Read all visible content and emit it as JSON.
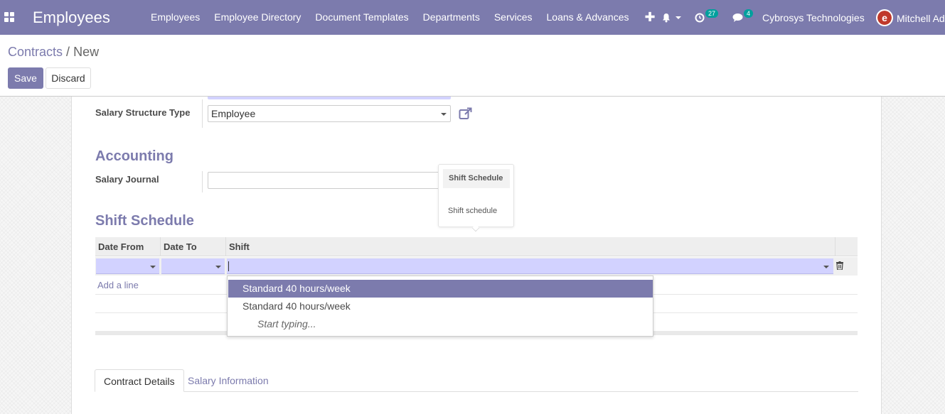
{
  "navbar": {
    "app_title": "Employees",
    "menu": [
      "Employees",
      "Employee Directory",
      "Document Templates",
      "Departments",
      "Services",
      "Loans & Advances"
    ],
    "plus": "✚",
    "activity_count": "27",
    "messages_count": "4",
    "company": "Cybrosys Technologies",
    "user": "Mitchell Admin",
    "accent_color": "#7c7bad"
  },
  "control_panel": {
    "breadcrumb_parent": "Contracts",
    "breadcrumb_separator": "/",
    "breadcrumb_current": "New",
    "save_label": "Save",
    "discard_label": "Discard"
  },
  "form": {
    "salary_structure_type_label": "Salary Structure Type",
    "salary_structure_type_value": "Employee",
    "accounting_title": "Accounting",
    "salary_journal_label": "Salary Journal",
    "salary_journal_value": "",
    "shift_schedule_title": "Shift Schedule"
  },
  "tooltip": {
    "title": "Shift Schedule",
    "body": "Shift schedule"
  },
  "table": {
    "columns": [
      "Date From",
      "Date To",
      "Shift"
    ],
    "add_line": "Add a line"
  },
  "dropdown": {
    "items": [
      "Standard 40 hours/week",
      "Standard 40 hours/week"
    ],
    "hint": "Start typing..."
  },
  "tabs": [
    "Contract Details",
    "Salary Information"
  ]
}
